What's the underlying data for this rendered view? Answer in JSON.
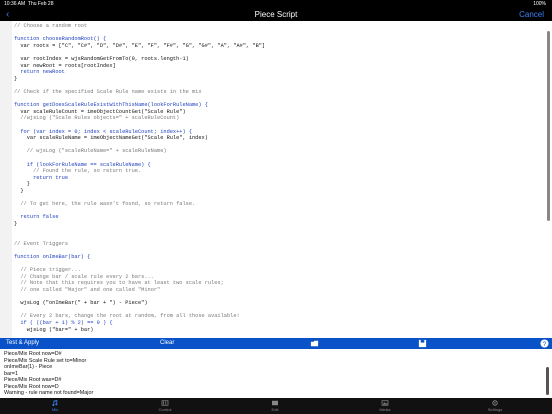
{
  "status": {
    "time": "10:36 AM",
    "date": "Thu Feb 28",
    "battery": "100%"
  },
  "nav": {
    "title": "Piece Script",
    "cancel": "Cancel"
  },
  "code_lines": [
    {
      "t": "// Choose a random root",
      "c": "cmt",
      "i": 0
    },
    {
      "t": "",
      "c": "plain",
      "i": 0
    },
    {
      "t": "function chooseRandomRoot() {",
      "c": "kw",
      "i": 0
    },
    {
      "t": "  var roots = [\"C\", \"C#\", \"D\", \"D#\", \"E\", \"F\", \"F#\", \"G\", \"G#\", \"A\", \"A#\", \"B\"]",
      "c": "plain",
      "i": 0
    },
    {
      "t": "",
      "c": "plain",
      "i": 0
    },
    {
      "t": "  var rootIndex = wjsRandomGetFromTo(0, roots.length-1)",
      "c": "plain",
      "i": 0
    },
    {
      "t": "  var newRoot = roots[rootIndex]",
      "c": "plain",
      "i": 0
    },
    {
      "t": "  return newRoot",
      "c": "kw",
      "i": 0
    },
    {
      "t": "}",
      "c": "plain",
      "i": 0
    },
    {
      "t": "",
      "c": "plain",
      "i": 0
    },
    {
      "t": "// Check if the specified Scale Rule name exists in the mix",
      "c": "cmt",
      "i": 0
    },
    {
      "t": "",
      "c": "plain",
      "i": 0
    },
    {
      "t": "function getDoesScaleRuleExistWithThisName(lookForRuleName) {",
      "c": "kw",
      "i": 0
    },
    {
      "t": "  var scaleRuleCount = imeObjectCountGet(\"Scale Rule\")",
      "c": "plain",
      "i": 0
    },
    {
      "t": "  //wjsLog (\"Scale Rules objects=\" + scaleRuleCount)",
      "c": "cmt",
      "i": 0
    },
    {
      "t": "",
      "c": "plain",
      "i": 0
    },
    {
      "t": "  for (var index = 0; index < scaleRuleCount; index++) {",
      "c": "kw",
      "i": 0
    },
    {
      "t": "    var scaleRuleName = imeObjectNameGet(\"Scale Rule\", index)",
      "c": "plain",
      "i": 0
    },
    {
      "t": "",
      "c": "plain",
      "i": 0
    },
    {
      "t": "    // wjsLog (\"scaleRuleName=\" + scaleRuleName)",
      "c": "cmt",
      "i": 0
    },
    {
      "t": "",
      "c": "plain",
      "i": 0
    },
    {
      "t": "    if (lookForRuleName == scaleRuleName) {",
      "c": "kw",
      "i": 0
    },
    {
      "t": "      // Found the rule, so return true.",
      "c": "cmt",
      "i": 0
    },
    {
      "t": "      return true",
      "c": "kw",
      "i": 0
    },
    {
      "t": "    }",
      "c": "plain",
      "i": 0
    },
    {
      "t": "  }",
      "c": "plain",
      "i": 0
    },
    {
      "t": "",
      "c": "plain",
      "i": 0
    },
    {
      "t": "  // To get here, the rule wasn't found, so return false.",
      "c": "cmt",
      "i": 0
    },
    {
      "t": "",
      "c": "plain",
      "i": 0
    },
    {
      "t": "  return false",
      "c": "kw",
      "i": 0
    },
    {
      "t": "}",
      "c": "plain",
      "i": 0
    },
    {
      "t": "",
      "c": "plain",
      "i": 0
    },
    {
      "t": "",
      "c": "plain",
      "i": 0
    },
    {
      "t": "// Event Triggers",
      "c": "cmt",
      "i": 0
    },
    {
      "t": "",
      "c": "plain",
      "i": 0
    },
    {
      "t": "function onImeBar(bar) {",
      "c": "kw",
      "i": 0
    },
    {
      "t": "",
      "c": "plain",
      "i": 0
    },
    {
      "t": "  // Piece trigger...",
      "c": "cmt",
      "i": 0
    },
    {
      "t": "  // Change bar / scale rule every 2 bars...",
      "c": "cmt",
      "i": 0
    },
    {
      "t": "  // Note that this requires you to have at least two scale rules;",
      "c": "cmt",
      "i": 0
    },
    {
      "t": "  // one called \"Major\" and one called \"Minor\"",
      "c": "cmt",
      "i": 0
    },
    {
      "t": "",
      "c": "plain",
      "i": 0
    },
    {
      "t": "  wjsLog (\"onImeBar(\" + bar + \") - Piece\")",
      "c": "plain",
      "i": 0
    },
    {
      "t": "",
      "c": "plain",
      "i": 0
    },
    {
      "t": "  // Every 2 bars, change the root at random, from all those available!",
      "c": "cmt",
      "i": 0
    },
    {
      "t": "  if ( ((bar + 1) % 2) == 0 ) {",
      "c": "kw",
      "i": 0
    },
    {
      "t": "    wjsLog (\"bar=\" + bar)",
      "c": "plain",
      "i": 0
    }
  ],
  "toolbar": {
    "test_apply": "Test & Apply",
    "clear": "Clear"
  },
  "console_lines": [
    "Piece/Mix Root now=D#",
    "Piece/Mix Scale Rule set to=Minor",
    "onImeBar(1) - Piece",
    "bar=1",
    "Piece/Mix Root was=D#",
    "Piece/Mix Root now=D",
    "Warning - rule name not found=Major"
  ],
  "tabs": [
    {
      "label": "Mix",
      "icon": "music-icon"
    },
    {
      "label": "Control",
      "icon": "control-icon"
    },
    {
      "label": "Edit",
      "icon": "edit-icon"
    },
    {
      "label": "Media",
      "icon": "media-icon"
    },
    {
      "label": "Settings",
      "icon": "gear-icon"
    }
  ],
  "colors": {
    "accent": "#3b82f6",
    "toolbar": "#0a52c8"
  }
}
